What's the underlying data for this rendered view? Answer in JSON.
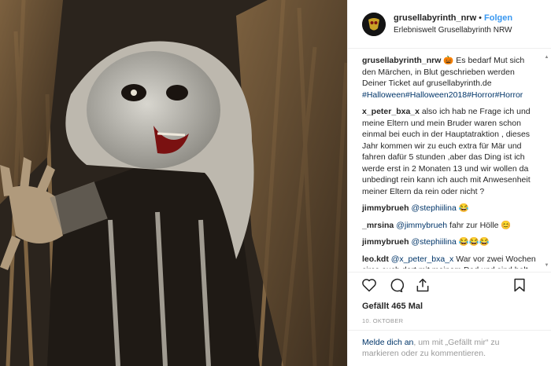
{
  "post": {
    "username": "grusellabyrinth_nrw",
    "follow_label": "Folgen",
    "dot": "•",
    "location": "Erlebniswelt Grusellabyrinth NRW"
  },
  "comments": [
    {
      "user": "grusellabyrinth_nrw",
      "text": " 🎃 Es bedarf Mut sich den Märchen, in Blut geschrieben werden Deiner Ticket auf grusellabyrinth.de",
      "tags": "#Halloween#Halloween2018#Horror#Horror"
    },
    {
      "user": "x_peter_bxa_x",
      "text": " also ich hab ne Frage ich und meine Eltern und mein Bruder waren schon einmal bei euch in der Hauptatraktion , dieses Jahr kommen wir zu euch extra für Mär und fahren dafür 5 stunden ,aber das Ding ist ich werde erst in 2 Monaten 13 und wir wollen da unbedingt rein kann ich auch mit Anwesenheit meiner Eltern da rein oder nicht ?"
    },
    {
      "user": "jimmybrueh",
      "mention": "@stephiilina",
      "text": " 😂"
    },
    {
      "user": "_mrsina",
      "mention": "@jimmybrueh",
      "text": " fahr zur Hölle 😊"
    },
    {
      "user": "jimmybrueh",
      "mention": "@stephiilina",
      "text": " 😂😂😂"
    },
    {
      "user": "leo.kdt",
      "mention": "@x_peter_bxa_x",
      "text": " War vor zwei Wochen circa auch dort mit meinem Dad und sind halt auch in die(?) Mär gegangen"
    }
  ],
  "icons": {
    "like": "heart-icon",
    "comment": "comment-bubble-icon",
    "share": "share-icon",
    "save": "bookmark-icon"
  },
  "likes_label": "Gefällt 465 Mal",
  "date": "10. OKTOBER",
  "login": {
    "link": "Melde dich an",
    "text": ", um mit „Gefällt mir“ zu markieren oder zu kommentieren."
  },
  "colors": {
    "link_blue": "#3897f0",
    "tag_blue": "#003569",
    "muted": "#999999"
  }
}
